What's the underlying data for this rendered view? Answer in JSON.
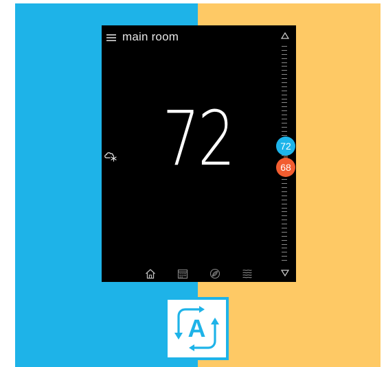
{
  "colors": {
    "left_panel": "#1eb3e8",
    "right_panel": "#fec965",
    "screen_bg": "#000000",
    "cool_setpoint": "#1db4ea",
    "heat_setpoint": "#f25d30",
    "badge_accent": "#1eb3e8"
  },
  "header": {
    "menu_icon": "hamburger-menu-icon",
    "room_name": "main room"
  },
  "display": {
    "current_temperature": "72",
    "mode_icon": "cloud-snowflake-icon"
  },
  "setpoints": {
    "cool": "72",
    "heat": "68"
  },
  "scale": {
    "up_icon": "triangle-up-icon",
    "down_icon": "triangle-down-icon"
  },
  "bottom_nav": {
    "items": [
      {
        "icon": "home-icon"
      },
      {
        "icon": "calendar-icon"
      },
      {
        "icon": "leaf-icon"
      },
      {
        "icon": "waves-icon"
      }
    ]
  },
  "badge": {
    "letter": "A",
    "icon": "auto-mode-badge-icon"
  }
}
